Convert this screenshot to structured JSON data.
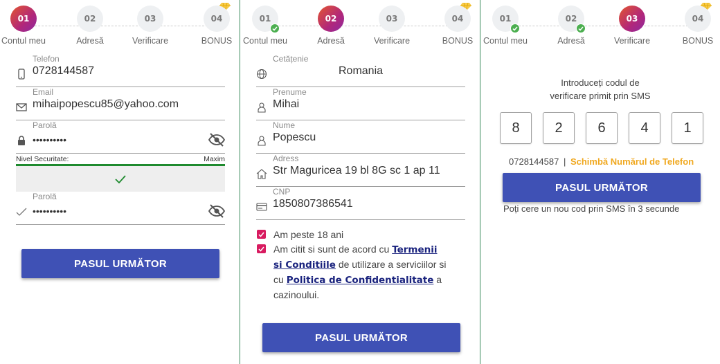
{
  "colors": {
    "accent": "#3f51b5",
    "active_gradient": [
      "#e4572e",
      "#8d2aa0"
    ],
    "success": "#4caf50",
    "checkbox": "#d81b60",
    "link_orange": "#f0a81f",
    "divider": "#3a8a5a"
  },
  "steps": [
    {
      "number": "01",
      "label": "Contul meu"
    },
    {
      "number": "02",
      "label": "Adresă"
    },
    {
      "number": "03",
      "label": "Verificare"
    },
    {
      "number": "04",
      "label": "BONUS",
      "icon": "diamond-icon"
    }
  ],
  "panel1": {
    "active_step": "01",
    "phone": {
      "label": "Telefon",
      "value": "0728144587",
      "icon": "phone-icon"
    },
    "email": {
      "label": "Email",
      "value": "mihaipopescu85@yahoo.com",
      "icon": "envelope-icon"
    },
    "password": {
      "label": "Parolă",
      "value": "••••••••••",
      "icon": "lock-icon"
    },
    "security": {
      "label": "Nivel Securitate:",
      "level": "Maxim"
    },
    "password_confirm": {
      "label": "Parolă",
      "value": "••••••••••",
      "icon": "checkmark-icon"
    },
    "next_button": "PASUL URMĂTOR"
  },
  "panel2": {
    "active_step": "02",
    "citizenship": {
      "label": "Cetățenie",
      "value": "Romania",
      "icon": "globe-icon"
    },
    "first_name": {
      "label": "Prenume",
      "value": "Mihai",
      "icon": "person-icon"
    },
    "last_name": {
      "label": "Nume",
      "value": "Popescu",
      "icon": "person-icon"
    },
    "address": {
      "label": "Adress",
      "value": "Str Maguricea 19 bl 8G sc 1 ap 11",
      "icon": "home-icon"
    },
    "cnp": {
      "label": "CNP",
      "value": "1850807386541",
      "icon": "id-card-icon"
    },
    "age_checkbox": "Am peste 18 ani",
    "terms": {
      "prefix": "Am citit si sunt de acord cu",
      "terms_link": "Termenii si Conditiile",
      "middle": "de utilizare a serviciilor si cu",
      "privacy_link": "Politica de Confidentialitate",
      "suffix": "a cazinoului."
    },
    "next_button": "PASUL URMĂTOR"
  },
  "panel3": {
    "active_step": "03",
    "intro_line1": "Introduceți codul de",
    "intro_line2": "verificare primit prin SMS",
    "code": [
      "8",
      "2",
      "6",
      "4",
      "1"
    ],
    "phone": "0728144587",
    "separator": "|",
    "change_phone": "Schimbă Numărul de Telefon",
    "next_button": "PASUL URMĂTOR",
    "resend_text": "Poți cere un nou cod prin SMS în 3 secunde"
  }
}
